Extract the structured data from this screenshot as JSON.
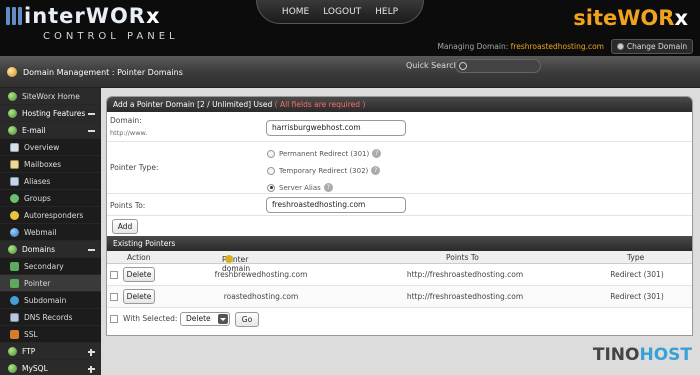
{
  "header": {
    "logo_main": "interWOR",
    "logo_x": "x",
    "logo_sub": "CONTROL PANEL",
    "nav": [
      "HOME",
      "LOGOUT",
      "HELP"
    ],
    "brand_main": "siteWOR",
    "brand_x": "x",
    "managing_label": "Managing Domain:",
    "managing_domain": "freshroastedhosting.com",
    "change_domain": "Change Domain"
  },
  "breadcrumb": {
    "text": "Domain Management : Pointer Domains",
    "quick_search": "Quick Search"
  },
  "sidebar": {
    "items": [
      {
        "label": "SiteWorx Home"
      },
      {
        "label": "Hosting Features"
      },
      {
        "label": "E-mail"
      },
      {
        "label": "Overview"
      },
      {
        "label": "Mailboxes"
      },
      {
        "label": "Aliases"
      },
      {
        "label": "Groups"
      },
      {
        "label": "Autoresponders"
      },
      {
        "label": "Webmail"
      },
      {
        "label": "Domains"
      },
      {
        "label": "Secondary"
      },
      {
        "label": "Pointer"
      },
      {
        "label": "Subdomain"
      },
      {
        "label": "DNS Records"
      },
      {
        "label": "SSL"
      },
      {
        "label": "FTP"
      },
      {
        "label": "MySQL"
      }
    ]
  },
  "form": {
    "title": "Add a Pointer Domain [2 / Unlimited] Used",
    "title_note": "( All fields are required )",
    "domain_label": "Domain:",
    "domain_hint": "http://www.",
    "domain_value": "harrisburgwebhost.com",
    "pointer_type_label": "Pointer Type:",
    "options": [
      "Permanent Redirect (301)",
      "Temporary Redirect (302)",
      "Server Alias"
    ],
    "selected_option": "Server Alias",
    "points_to_label": "Points To:",
    "points_to_value": "freshroastedhosting.com",
    "add_button": "Add"
  },
  "existing": {
    "title": "Existing Pointers",
    "columns": [
      "Action",
      "Pointer domain",
      "Points To",
      "Type"
    ],
    "rows": [
      {
        "action": "Delete",
        "domain": "freshbrewedhosting.com",
        "points_to": "http://freshroastedhosting.com",
        "type": "Redirect (301)"
      },
      {
        "action": "Delete",
        "domain": "roastedhosting.com",
        "points_to": "http://freshroastedhosting.com",
        "type": "Redirect (301)"
      }
    ],
    "with_selected_label": "With Selected:",
    "bulk_action": "Delete",
    "go_button": "Go"
  },
  "watermark": {
    "part1": "TINO",
    "part2": "HOST"
  },
  "colors": {
    "accent": "#f1a31e",
    "header_bg": "#0c0c0c",
    "required_note": "#ff6a6a",
    "watermark_accent": "#3aa0d8"
  }
}
